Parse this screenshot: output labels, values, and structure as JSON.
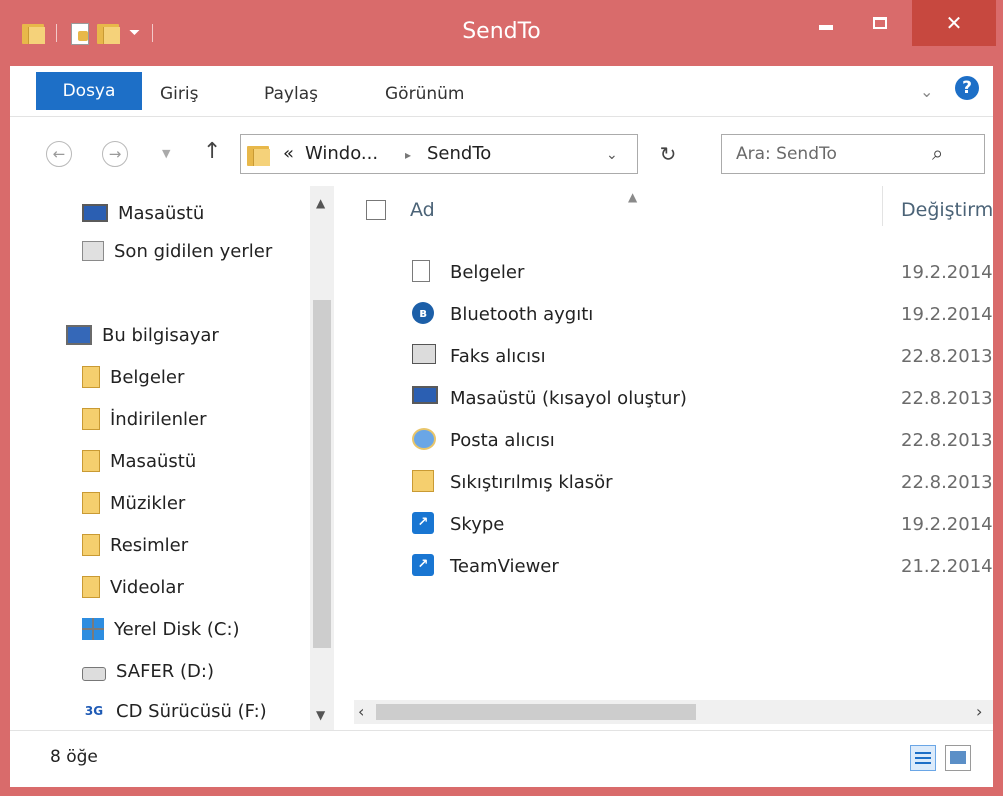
{
  "window": {
    "title": "SendTo"
  },
  "ribbon": {
    "tabs": [
      "Dosya",
      "Giriş",
      "Paylaş",
      "Görünüm"
    ]
  },
  "address": {
    "prefix": "«",
    "crumbs": [
      "Windo...",
      "SendTo"
    ],
    "separator": "▸"
  },
  "search": {
    "placeholder": "Ara: SendTo"
  },
  "nav": {
    "items": [
      {
        "label": "Masaüstü",
        "icon": "desktop-icon"
      },
      {
        "label": "Son gidilen yerler",
        "icon": "recent-places-icon"
      },
      {
        "label": "Bu bilgisayar",
        "icon": "computer-icon"
      },
      {
        "label": "Belgeler",
        "icon": "documents-folder-icon"
      },
      {
        "label": "İndirilenler",
        "icon": "downloads-folder-icon"
      },
      {
        "label": "Masaüstü",
        "icon": "desktop-folder-icon"
      },
      {
        "label": "Müzikler",
        "icon": "music-folder-icon"
      },
      {
        "label": "Resimler",
        "icon": "pictures-folder-icon"
      },
      {
        "label": "Videolar",
        "icon": "videos-folder-icon"
      },
      {
        "label": "Yerel Disk (C:)",
        "icon": "local-disk-icon"
      },
      {
        "label": "SAFER (D:)",
        "icon": "removable-drive-icon"
      },
      {
        "label": "CD Sürücüsü (F:)",
        "icon": "cd-drive-icon"
      }
    ]
  },
  "files": {
    "columns": {
      "name": "Ad",
      "date": "Değiştirme tarihi"
    },
    "rows": [
      {
        "name": "Belgeler",
        "date": "19.2.2014",
        "icon": "documents-icon"
      },
      {
        "name": "Bluetooth aygıtı",
        "date": "19.2.2014",
        "icon": "bluetooth-icon"
      },
      {
        "name": "Faks alıcısı",
        "date": "22.8.2013",
        "icon": "fax-icon"
      },
      {
        "name": "Masaüstü (kısayol oluştur)",
        "date": "22.8.2013",
        "icon": "desktop-shortcut-icon"
      },
      {
        "name": "Posta alıcısı",
        "date": "22.8.2013",
        "icon": "mail-icon"
      },
      {
        "name": "Sıkıştırılmış klasör",
        "date": "22.8.2013",
        "icon": "zip-folder-icon"
      },
      {
        "name": "Skype",
        "date": "19.2.2014",
        "icon": "skype-shortcut-icon"
      },
      {
        "name": "TeamViewer",
        "date": "21.2.2014",
        "icon": "teamviewer-shortcut-icon"
      }
    ]
  },
  "status": {
    "count": "8 öğe"
  },
  "colors": {
    "frame": "#d96b6b",
    "accent": "#1d6fc7",
    "close": "#c7483f"
  }
}
